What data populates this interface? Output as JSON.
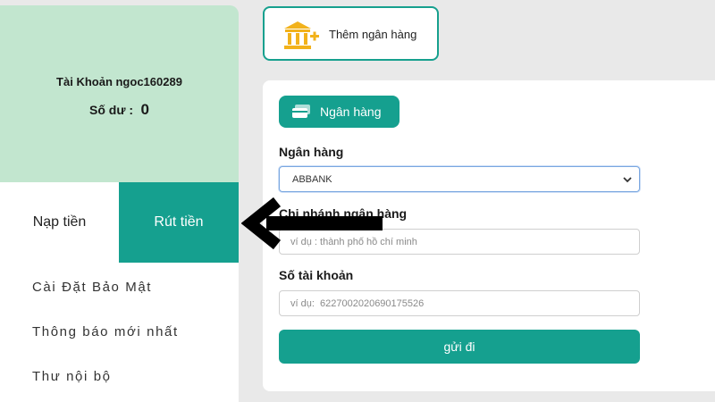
{
  "account": {
    "name_text": "Tài Khoản ngoc160289",
    "balance_label": "Số dư :",
    "balance_value": "0"
  },
  "tabs": [
    {
      "label": "Nạp tiền",
      "active": false
    },
    {
      "label": "Rút tiền",
      "active": true
    }
  ],
  "menu": {
    "items": [
      {
        "label": "Cài Đặt Bảo Mật"
      },
      {
        "label": "Thông báo mới nhất"
      },
      {
        "label": "Thư nội bộ"
      }
    ]
  },
  "add_bank": {
    "label": "Thêm ngân hàng",
    "icon": "bank-add-icon"
  },
  "form": {
    "bank_pill": {
      "label": "Ngân hàng",
      "icon": "card-icon"
    },
    "bank_field": {
      "label": "Ngân hàng",
      "selected": "ABBANK"
    },
    "branch_field": {
      "label": "Chi nhánh ngân hàng",
      "placeholder": "ví dụ : thành phố hồ chí minh"
    },
    "account_number_field": {
      "label": "Số tài khoản",
      "placeholder": "ví dụ:  6227002020690175526"
    },
    "submit_label": "gửi đi"
  },
  "colors": {
    "accent": "#15a08f",
    "account_bg": "#c2e6cf",
    "page_bg": "#e9e9e9",
    "bank_icon": "#f2b21b"
  }
}
